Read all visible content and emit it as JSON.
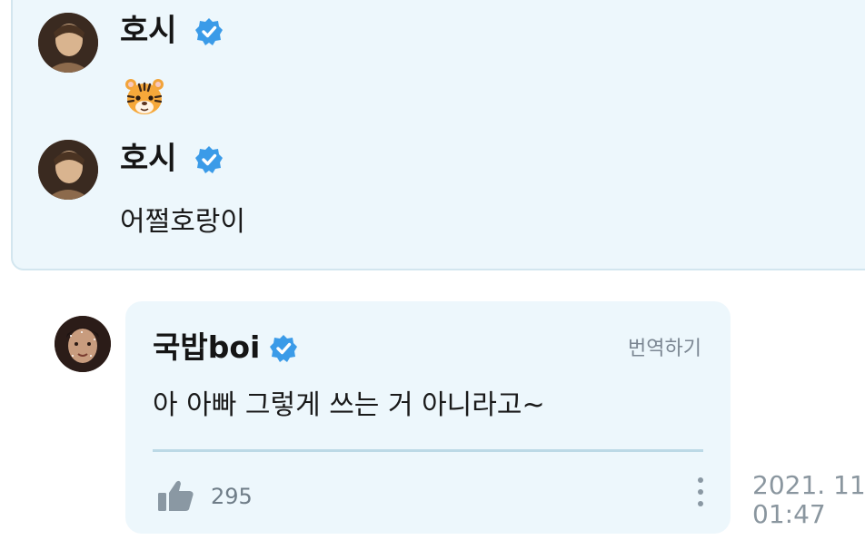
{
  "comments": [
    {
      "author": "호시",
      "verified": true,
      "text": "🐯",
      "avatar_icon": "profile-photo-hoshi"
    },
    {
      "author": "호시",
      "verified": true,
      "text": "어쩔호랑이",
      "avatar_icon": "profile-photo-hoshi"
    }
  ],
  "reply": {
    "author": "국밥boi",
    "verified": true,
    "translate_label": "번역하기",
    "text": "아 아빠 그렇게 쓰는 거 아니라고~",
    "likes": "295",
    "date": "2021. 11.",
    "time": "01:47"
  },
  "colors": {
    "card_background": "#edf7fc",
    "verified_badge": "#3b9be8",
    "muted_text": "#7b8692"
  }
}
